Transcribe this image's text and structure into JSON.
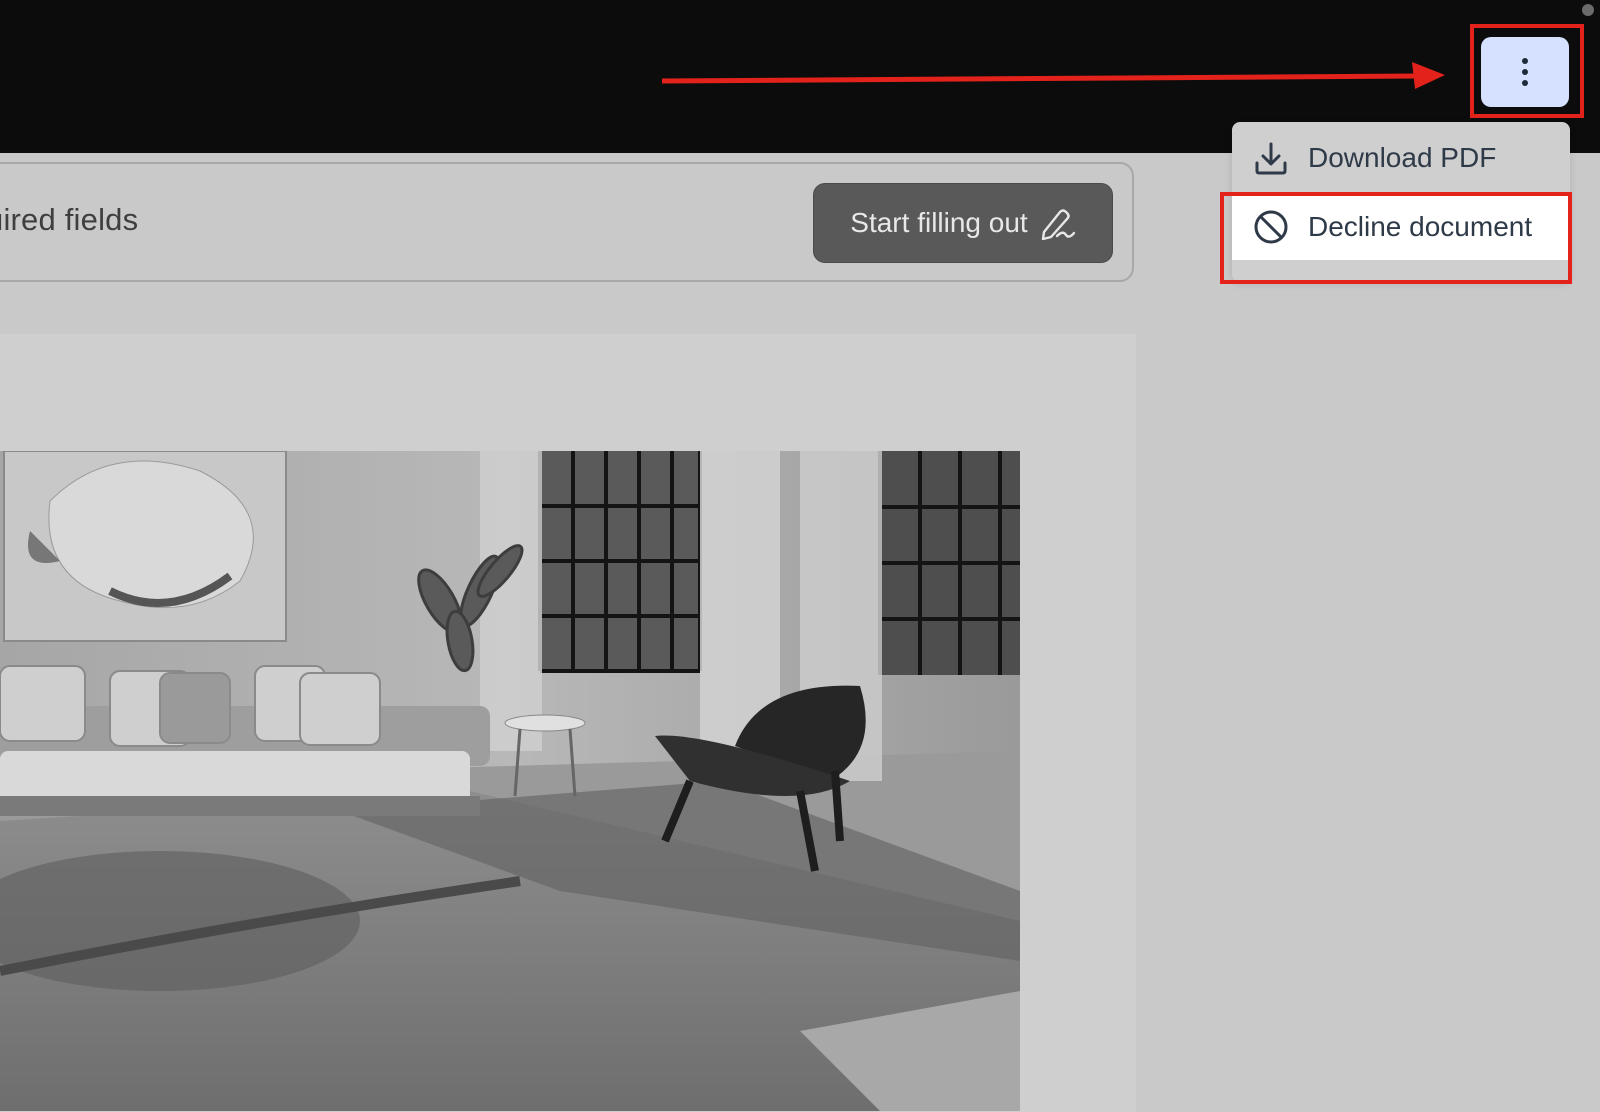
{
  "toolbar": {
    "menu_icon": "more-vertical-icon"
  },
  "dropdown": {
    "items": [
      {
        "label": "Download PDF",
        "icon": "download-icon"
      },
      {
        "label": "Decline document",
        "icon": "ban-icon"
      }
    ]
  },
  "banner": {
    "text": "uired fields",
    "start_button_label": "Start filling out",
    "start_button_icon": "signature-pen-icon"
  },
  "colors": {
    "annotation": "#e3221b",
    "menu_button_bg": "#d6e0ff",
    "topbar_bg": "#0c0c0c",
    "overlay_bg": "#c9c9c9"
  }
}
